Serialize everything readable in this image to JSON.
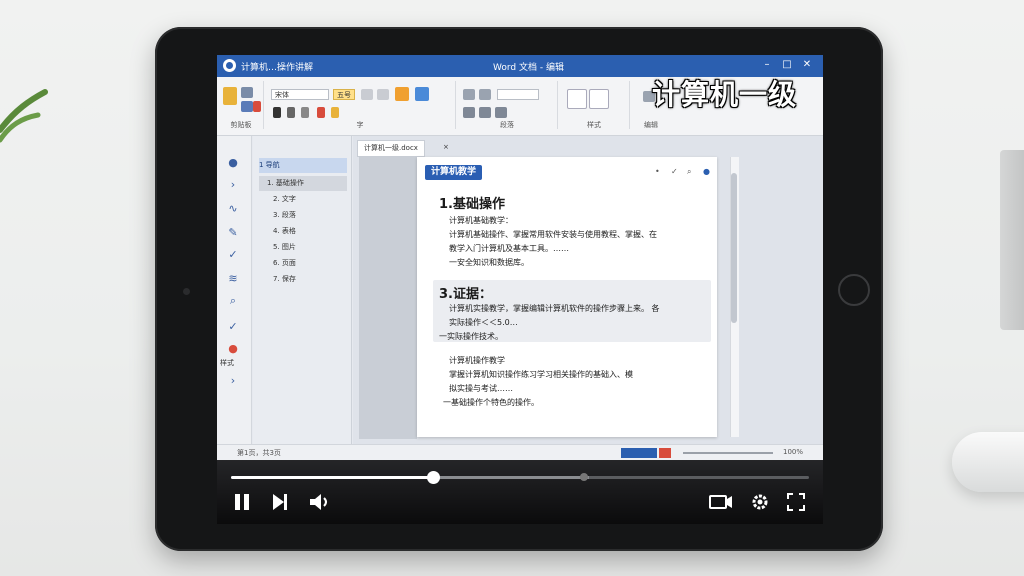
{
  "overlay": {
    "title": "计算机一级"
  },
  "window": {
    "title_left": "计算机…操作讲解",
    "title_center": "Word 文档 - 编辑",
    "controls": [
      "–",
      "□",
      "✕"
    ]
  },
  "ribbon": {
    "groups": [
      "剪贴板",
      "字",
      "段落",
      "样式",
      "编辑"
    ],
    "font_name": "宋体",
    "font_size": "五号"
  },
  "nav": {
    "items": [
      {
        "label": "1 导航",
        "state": "selected"
      },
      {
        "label": "1. 基础操作",
        "state": "sub"
      },
      {
        "label": "2. 文字",
        "state": ""
      },
      {
        "label": "3. 段落",
        "state": ""
      },
      {
        "label": "4. 表格",
        "state": ""
      },
      {
        "label": "5. 图片",
        "state": ""
      },
      {
        "label": "6. 页面",
        "state": ""
      },
      {
        "label": "7. 保存",
        "state": ""
      }
    ]
  },
  "left_toolbar": {
    "label": "样式"
  },
  "doc_tabs": [
    "计算机一级.docx",
    "×"
  ],
  "document": {
    "header_tag": "计算机教学",
    "sections": [
      {
        "heading": "1.基础操作",
        "lines": [
          "计算机基础教学：",
          "计算机基础操作、掌握常用软件安装与使用教程、掌握、在",
          "教学入门计算机及基本工具。……",
          "一安全知识和数据库。"
        ]
      },
      {
        "heading": "3.证据：",
        "lines": [
          "计算机实操教学，掌握编辑计算机软件的操作步骤上来。  各",
          "实际操作＜＜5.0…",
          "一实际操作技术。"
        ]
      },
      {
        "heading": "",
        "lines": [
          "计算机操作教学",
          "掌握计算机知识操作练习学习相关操作的基础入、模",
          "拟实操与考试……",
          "一基础操作个特色的操作。"
        ]
      }
    ]
  },
  "status": {
    "left": "第1页，共3页",
    "right": "100%"
  },
  "player": {
    "progress_fraction": 0.35,
    "buffered_fraction": 0.62,
    "chapter_fraction": 0.61,
    "play_icon": "pause-icon",
    "next_icon": "skip-next-icon",
    "volume_icon": "volume-icon",
    "right_icons": [
      "miniplayer-icon",
      "settings-icon",
      "fullscreen-icon"
    ]
  }
}
